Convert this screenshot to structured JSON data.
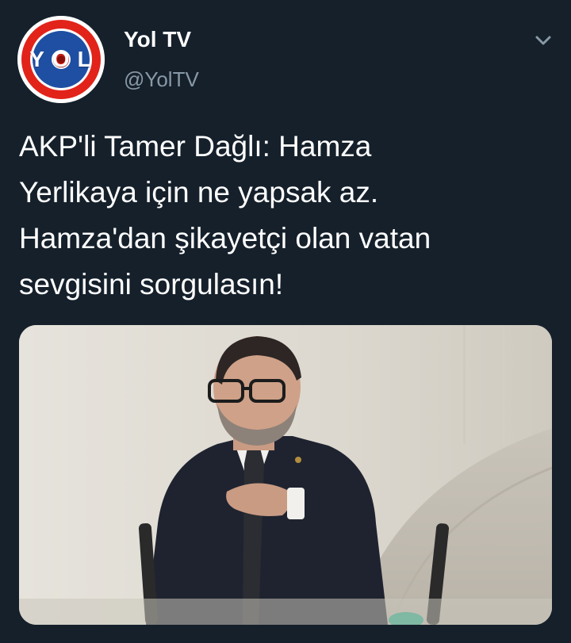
{
  "account": {
    "display_name": "Yol TV",
    "handle": "@YolTV",
    "avatar_logo_text": "YOL",
    "avatar_colors": {
      "ring": "#ffffff",
      "outer": "#e2231a",
      "inner": "#1e4fa3"
    }
  },
  "tweet": {
    "text_lines": [
      "AKP'li Tamer Dağlı: Hamza",
      "Yerlikaya için ne yapsak az.",
      "Hamza'dan şikayetçi olan vatan",
      "sevgisini sorgulasın!"
    ],
    "media": {
      "type": "photo"
    }
  },
  "icons": {
    "menu": "chevron-down-icon"
  },
  "theme": {
    "background": "#15202b",
    "text": "#ffffff",
    "secondary_text": "#8899a6"
  }
}
